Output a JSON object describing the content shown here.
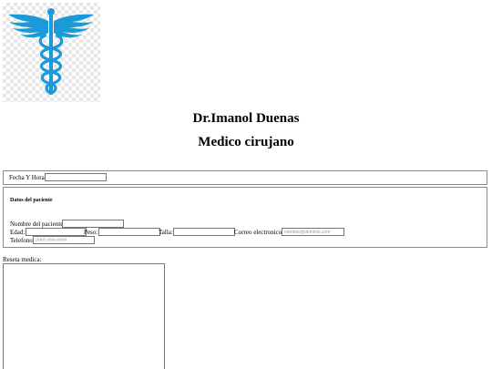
{
  "header": {
    "doctor_name": "Dr.Imanol Duenas",
    "specialty": "Medico cirujano"
  },
  "logo": {
    "icon": "caduceus-icon",
    "color": "#1a9bd7"
  },
  "visit": {
    "datetime_label": "Fecha Y Hora",
    "datetime_value": ""
  },
  "patient": {
    "title": "Datos del paciente",
    "name_label": "Nombre del paciente:",
    "name_value": "",
    "age_label": "Edad:",
    "age_value": "",
    "weight_label": "Peso:",
    "weight_value": "",
    "height_label": "Talla:",
    "height_value": "",
    "email_label": "Correo electronico:",
    "email_value": "",
    "email_placeholder": "nombre@dominio.com",
    "phone_label": "Telefono:",
    "phone_value": "",
    "phone_placeholder": "(###) ###-####"
  },
  "prescription": {
    "label": "Reseta medica:",
    "value": ""
  }
}
